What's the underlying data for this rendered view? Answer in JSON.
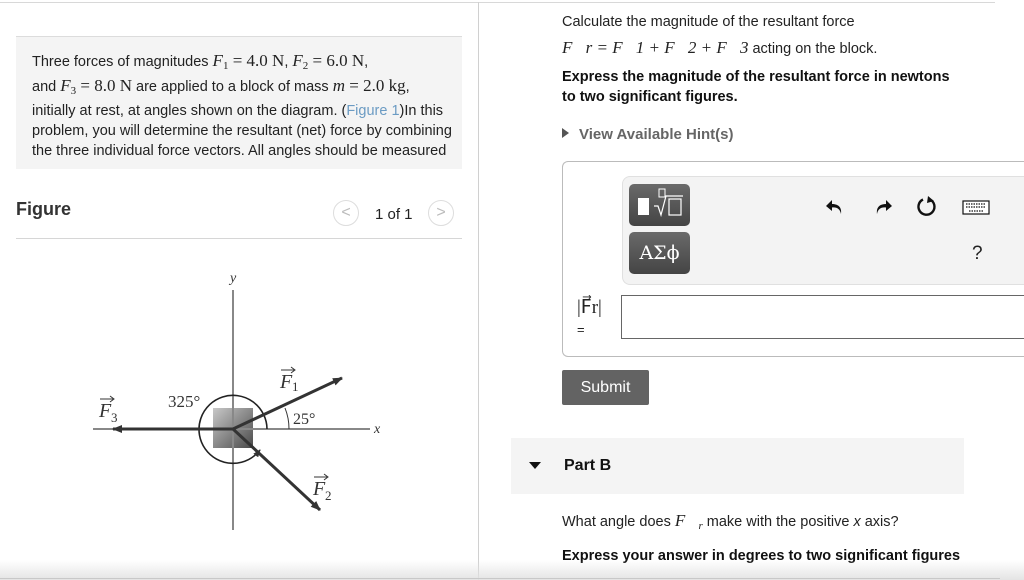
{
  "problem": {
    "text_intro": "Three forces of magnitudes ",
    "f1_label": "F",
    "f1_sub": "1",
    "f1_value": " = 4.0 N",
    "sep1": ", ",
    "f2_label": "F",
    "f2_sub": "2",
    "f2_value": " = 6.0 N",
    "sep2": ",",
    "and": "and ",
    "f3_label": "F",
    "f3_sub": "3",
    "f3_value": " = 8.0 N",
    "text_mid": " are applied to a block of mass ",
    "mass_label": "m",
    "mass_value": " = 2.0 kg",
    "text_after_mass": ", initially at rest, at angles shown on the diagram. (",
    "figure_link": "Figure 1",
    "text_end": ")In this problem, you will determine the resultant (net) force by combining the three individual force vectors. All angles should be measured"
  },
  "figure": {
    "title": "Figure",
    "pager": "1 of 1",
    "prev": "<",
    "next": ">",
    "diagram": {
      "y_axis": "y",
      "x_axis": "x",
      "f1": "F",
      "f1_sub": "1",
      "f2": "F",
      "f2_sub": "2",
      "f3": "F",
      "f3_sub": "3",
      "angle1": "25°",
      "angle2": "325°"
    }
  },
  "part_a": {
    "question_line1": "Calculate the magnitude of the resultant force",
    "question_line2_suffix": " acting on the block.",
    "equation": "F⃗r = F⃗1 + F⃗2 + F⃗3",
    "instruction": "Express the magnitude of the resultant force in newtons to two significant figures.",
    "hints": "View Available Hint(s)",
    "answer_label": "|F⃗r|",
    "answer_eq": "=",
    "answer_value": "",
    "toolbar": {
      "templates_icon": "fraction-root-template-icon",
      "symbols": "ΑΣϕ",
      "undo_icon": "undo-icon",
      "redo_icon": "redo-icon",
      "reset_icon": "reset-icon",
      "keyboard_icon": "keyboard-icon",
      "help": "?"
    },
    "submit": "Submit"
  },
  "part_b": {
    "label": "Part B",
    "question_prefix": "What angle does ",
    "question_suffix": " make with the positive ",
    "axis": "x",
    "question_end": " axis?",
    "instruction": "Express your answer in degrees to two significant figures"
  }
}
